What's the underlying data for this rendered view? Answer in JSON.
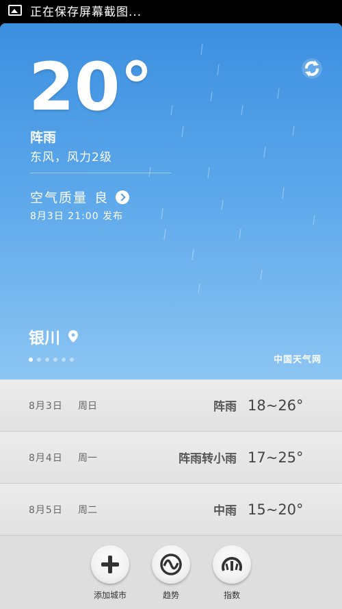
{
  "status_bar": {
    "text": "正在保存屏幕截图..."
  },
  "current": {
    "temperature": "20°",
    "condition": "阵雨",
    "wind": "东风，风力2级",
    "air_quality_label": "空气质量",
    "air_quality_value": "良",
    "published": "8月3日  21:00  发布",
    "city": "银川",
    "brand": "中国天气网"
  },
  "page_indicator": {
    "count": 6,
    "active": 1
  },
  "forecast": [
    {
      "date": "8月3日",
      "dow": "周日",
      "weather": "阵雨",
      "range": "18~26°"
    },
    {
      "date": "8月4日",
      "dow": "周一",
      "weather": "阵雨转小雨",
      "range": "17~25°"
    },
    {
      "date": "8月5日",
      "dow": "周二",
      "weather": "中雨",
      "range": "15~20°"
    }
  ],
  "toolbar": {
    "add_city": "添加城市",
    "trend": "趋势",
    "index": "指数"
  },
  "colors": {
    "sky_top": "#3b8fe0",
    "sky_bottom": "#8cc5f3",
    "icon": "#333333"
  }
}
